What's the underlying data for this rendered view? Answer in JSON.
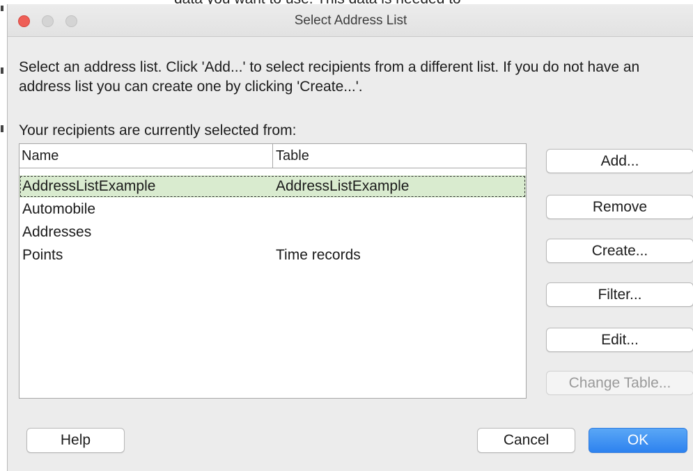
{
  "background": {
    "text": "data you want to use. This data is needed to"
  },
  "window": {
    "title": "Select Address List"
  },
  "instructions": "Select an address list. Click 'Add...' to select recipients from a different list. If you do not have an address list you can create one by clicking 'Create...'.",
  "recipients_label": "Your recipients are currently selected from:",
  "list": {
    "columns": [
      "Name",
      "Table"
    ],
    "rows": [
      {
        "name": "AddressListExample",
        "table": "AddressListExample",
        "selected": true
      },
      {
        "name": "Automobile",
        "table": ""
      },
      {
        "name": "Addresses",
        "table": ""
      },
      {
        "name": "Points",
        "table": "Time records"
      }
    ]
  },
  "side_buttons": [
    "Add...",
    "Remove",
    "Create...",
    "Filter...",
    "Edit...",
    "Change Table..."
  ],
  "footer_buttons": {
    "help": "Help",
    "cancel": "Cancel",
    "ok": "OK"
  },
  "colors": {
    "selection": "#d9ebcf",
    "ok_button": "#2d82ef",
    "close_light": "#ee5f57"
  }
}
